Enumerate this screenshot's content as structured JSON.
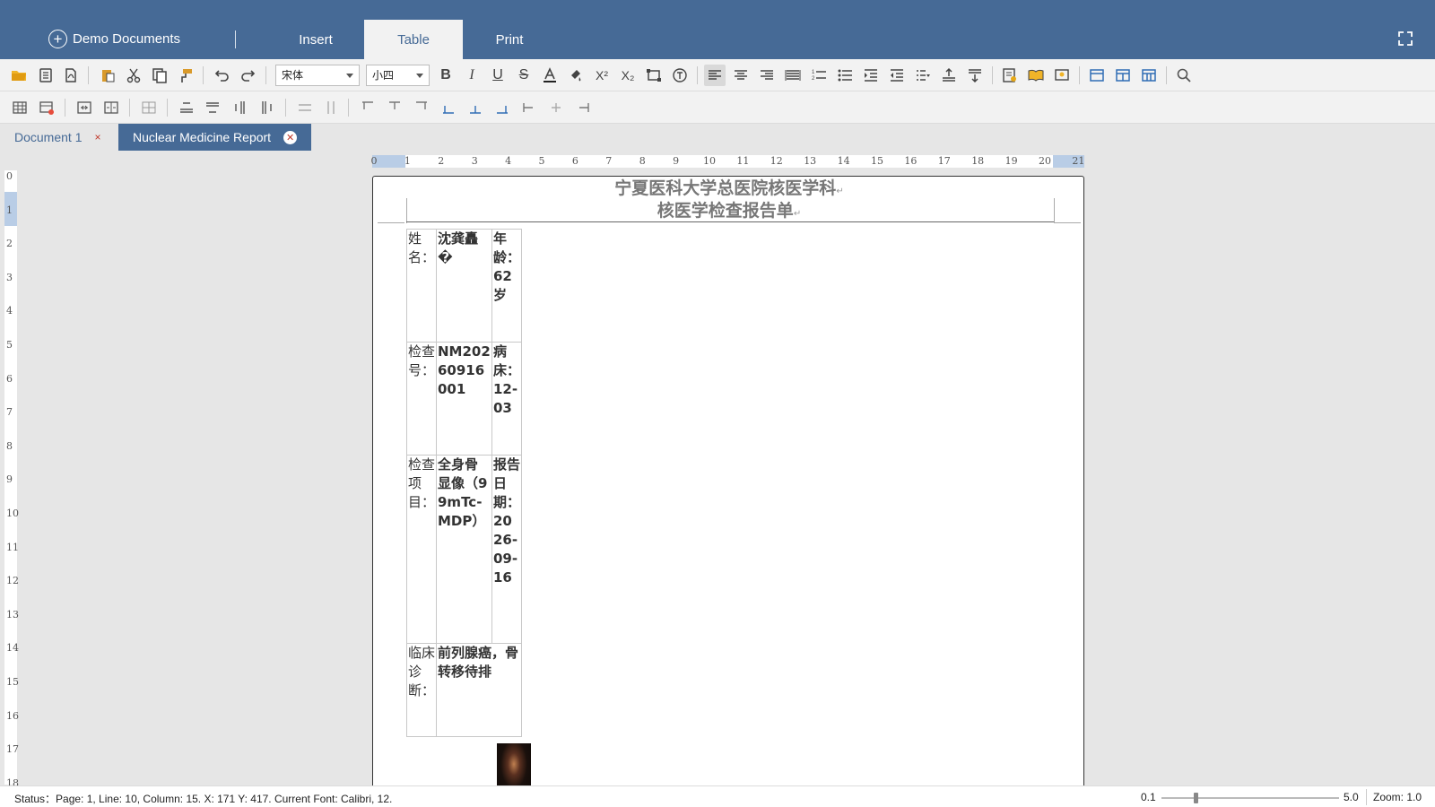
{
  "topbar": {
    "brand_label": "Demo Documents",
    "tabs": [
      {
        "label": "Insert"
      },
      {
        "label": "Table"
      },
      {
        "label": "Print"
      }
    ],
    "active_tab": "Table"
  },
  "toolbar": {
    "font_name": "宋体",
    "font_size": "小四"
  },
  "documents": {
    "tabs": [
      {
        "label": "Document 1",
        "close": "×"
      },
      {
        "label": "Nuclear Medicine Report",
        "close": "✕"
      }
    ],
    "active": "Nuclear Medicine Report"
  },
  "rulers": {
    "horizontal": [
      "0",
      "1",
      "2",
      "3",
      "4",
      "5",
      "6",
      "7",
      "8",
      "9",
      "10",
      "11",
      "12",
      "13",
      "14",
      "15",
      "16",
      "17",
      "18",
      "19",
      "20",
      "21"
    ],
    "vertical": [
      "0",
      "1",
      "2",
      "3",
      "4",
      "5",
      "6",
      "7",
      "8",
      "9",
      "10",
      "11",
      "12",
      "13",
      "14",
      "15",
      "16",
      "17",
      "18"
    ]
  },
  "document": {
    "title_line1": "宁夏医科大学总医院核医学科",
    "title_line2": "核医学检查报告单",
    "paragraph_mark": "↵",
    "rows": [
      {
        "label": "姓名：",
        "value": "沈龚矗�",
        "right": "年龄：62岁"
      },
      {
        "label": "检查号：",
        "value": "NM20260916001",
        "right": "病床：12-03"
      },
      {
        "label": "检查项目：",
        "value": "全身骨显像（99mTc-MDP）",
        "right": "报告日期：2026-09-16"
      },
      {
        "label": "临床诊断：",
        "value": "前列腺癌，骨转移待排",
        "right": ""
      }
    ]
  },
  "status": {
    "text": "Status：Page: 1, Line: 10, Column: 15.  X: 171 Y: 417.  Current Font: Calibri, 12.",
    "zoom_min": "0.1",
    "zoom_max": "5.0",
    "zoom_label": "Zoom: 1.0",
    "zoom_value": 1.0
  }
}
